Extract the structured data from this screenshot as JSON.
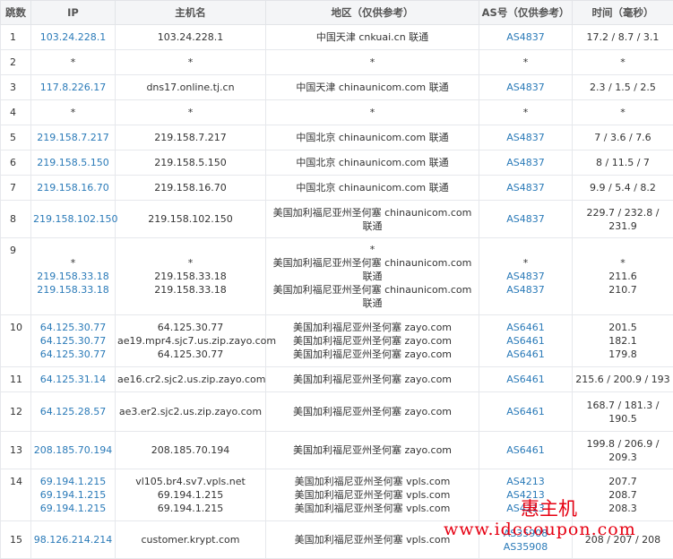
{
  "headers": {
    "hop": "跳数",
    "ip": "IP",
    "host": "主机名",
    "region": "地区（仅供参考）",
    "as": "AS号（仅供参考）",
    "time": "时间（毫秒）"
  },
  "rows": [
    {
      "hop": "1",
      "ips": [
        "103.24.228.1"
      ],
      "hosts": [
        "103.24.228.1"
      ],
      "regions": [
        "中国天津 cnkuai.cn 联通"
      ],
      "as": [
        "AS4837"
      ],
      "times": [
        "17.2 / 8.7 / 3.1"
      ]
    },
    {
      "hop": "2",
      "ips": [
        "*"
      ],
      "hosts": [
        "*"
      ],
      "regions": [
        "*"
      ],
      "as": [
        "*"
      ],
      "times": [
        "*"
      ]
    },
    {
      "hop": "3",
      "ips": [
        "117.8.226.17"
      ],
      "hosts": [
        "dns17.online.tj.cn"
      ],
      "regions": [
        "中国天津 chinaunicom.com 联通"
      ],
      "as": [
        "AS4837"
      ],
      "times": [
        "2.3 / 1.5 / 2.5"
      ]
    },
    {
      "hop": "4",
      "ips": [
        "*"
      ],
      "hosts": [
        "*"
      ],
      "regions": [
        "*"
      ],
      "as": [
        "*"
      ],
      "times": [
        "*"
      ]
    },
    {
      "hop": "5",
      "ips": [
        "219.158.7.217"
      ],
      "hosts": [
        "219.158.7.217"
      ],
      "regions": [
        "中国北京 chinaunicom.com 联通"
      ],
      "as": [
        "AS4837"
      ],
      "times": [
        "7 / 3.6 / 7.6"
      ]
    },
    {
      "hop": "6",
      "ips": [
        "219.158.5.150"
      ],
      "hosts": [
        "219.158.5.150"
      ],
      "regions": [
        "中国北京 chinaunicom.com 联通"
      ],
      "as": [
        "AS4837"
      ],
      "times": [
        "8 / 11.5 / 7"
      ]
    },
    {
      "hop": "7",
      "ips": [
        "219.158.16.70"
      ],
      "hosts": [
        "219.158.16.70"
      ],
      "regions": [
        "中国北京 chinaunicom.com 联通"
      ],
      "as": [
        "AS4837"
      ],
      "times": [
        "9.9 / 5.4 / 8.2"
      ]
    },
    {
      "hop": "8",
      "ips": [
        "219.158.102.150"
      ],
      "hosts": [
        "219.158.102.150"
      ],
      "regions": [
        "美国加利福尼亚州圣何塞 chinaunicom.com 联通"
      ],
      "as": [
        "AS4837"
      ],
      "times": [
        "229.7 / 232.8 / 231.9"
      ]
    },
    {
      "hop": "9",
      "ips": [
        "*",
        "219.158.33.18",
        "219.158.33.18"
      ],
      "hosts": [
        "*",
        "219.158.33.18",
        "219.158.33.18"
      ],
      "regions": [
        "*",
        "美国加利福尼亚州圣何塞 chinaunicom.com 联通",
        "美国加利福尼亚州圣何塞 chinaunicom.com 联通"
      ],
      "as": [
        "*",
        "AS4837",
        "AS4837"
      ],
      "times": [
        "*",
        "211.6",
        "210.7"
      ]
    },
    {
      "hop": "10",
      "ips": [
        "64.125.30.77",
        "64.125.30.77",
        "64.125.30.77"
      ],
      "hosts": [
        "64.125.30.77",
        "ae19.mpr4.sjc7.us.zip.zayo.com",
        "64.125.30.77"
      ],
      "regions": [
        "美国加利福尼亚州圣何塞 zayo.com",
        "美国加利福尼亚州圣何塞 zayo.com",
        "美国加利福尼亚州圣何塞 zayo.com"
      ],
      "as": [
        "AS6461",
        "AS6461",
        "AS6461"
      ],
      "times": [
        "201.5",
        "182.1",
        "179.8"
      ]
    },
    {
      "hop": "11",
      "ips": [
        "64.125.31.14"
      ],
      "hosts": [
        "ae16.cr2.sjc2.us.zip.zayo.com"
      ],
      "regions": [
        "美国加利福尼亚州圣何塞 zayo.com"
      ],
      "as": [
        "AS6461"
      ],
      "times": [
        "215.6 / 200.9 / 193"
      ]
    },
    {
      "hop": "12",
      "ips": [
        "64.125.28.57"
      ],
      "hosts": [
        "ae3.er2.sjc2.us.zip.zayo.com"
      ],
      "regions": [
        "美国加利福尼亚州圣何塞 zayo.com"
      ],
      "as": [
        "AS6461"
      ],
      "times": [
        "168.7 / 181.3 / 190.5"
      ]
    },
    {
      "hop": "13",
      "ips": [
        "208.185.70.194"
      ],
      "hosts": [
        "208.185.70.194"
      ],
      "regions": [
        "美国加利福尼亚州圣何塞 zayo.com"
      ],
      "as": [
        "AS6461"
      ],
      "times": [
        "199.8 / 206.9 / 209.3"
      ]
    },
    {
      "hop": "14",
      "ips": [
        "69.194.1.215",
        "69.194.1.215",
        "69.194.1.215"
      ],
      "hosts": [
        "vl105.br4.sv7.vpls.net",
        "69.194.1.215",
        "69.194.1.215"
      ],
      "regions": [
        "美国加利福尼亚州圣何塞 vpls.com",
        "美国加利福尼亚州圣何塞 vpls.com",
        "美国加利福尼亚州圣何塞 vpls.com"
      ],
      "as": [
        "AS4213",
        "AS4213",
        "AS4213"
      ],
      "times": [
        "207.7",
        "208.7",
        "208.3"
      ]
    },
    {
      "hop": "15",
      "ips": [
        "98.126.214.214"
      ],
      "hosts": [
        "customer.krypt.com"
      ],
      "regions": [
        "美国加利福尼亚州圣何塞 vpls.com"
      ],
      "as": [
        "AS35908",
        "AS35908"
      ],
      "times": [
        "208 / 207 / 208"
      ]
    }
  ],
  "watermark": {
    "brand": "惠主机",
    "url": "www.idccoupon.com"
  },
  "colors": {
    "link": "#2a7ab8",
    "watermark": "#e60012",
    "header_bg": "#f4f5f7"
  }
}
